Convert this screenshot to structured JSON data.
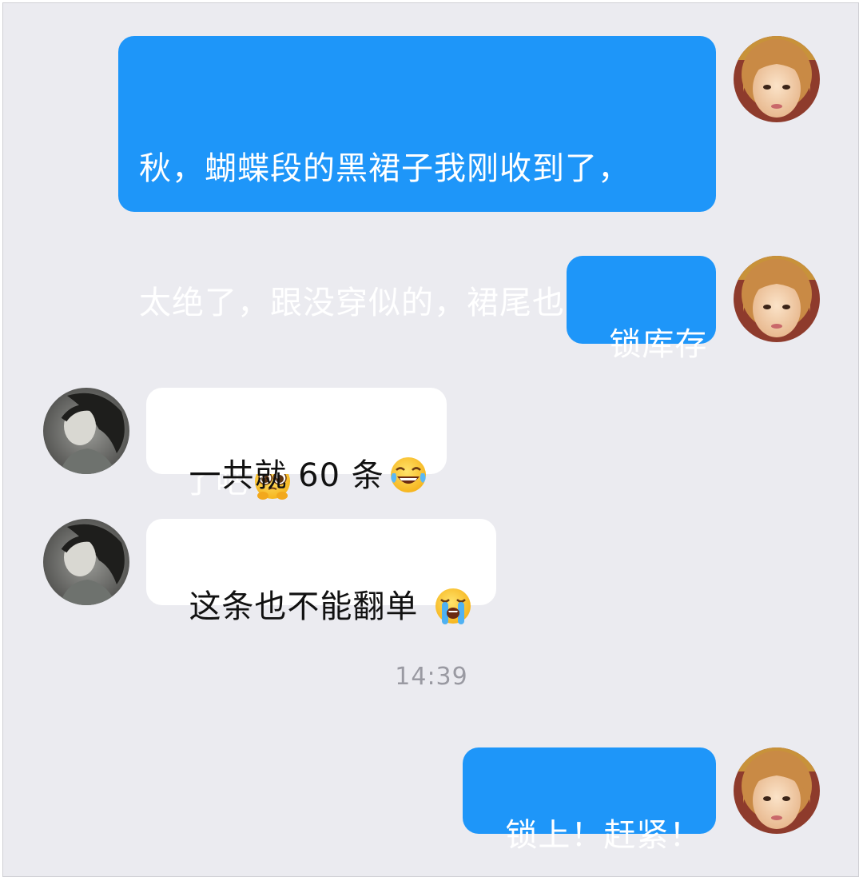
{
  "chat": {
    "messages": [
      {
        "direction": "outgoing",
        "lines": [
          "秋，蝴蝶段的黑裙子我刚收到了，",
          "太绝了，跟没穿似的，裙尾也太美",
          "了吧"
        ],
        "emoji": "pleading-face-emoji"
      },
      {
        "direction": "outgoing",
        "text": "锁库存"
      },
      {
        "direction": "incoming",
        "text": "一共就 60 条",
        "emoji": "tears-of-joy-emoji"
      },
      {
        "direction": "incoming",
        "text": "这条也不能翻单 ",
        "emoji": "loudly-crying-face-emoji"
      },
      {
        "direction": "outgoing",
        "text": "锁上！赶紧！"
      }
    ],
    "timestamp": "14:39"
  },
  "colors": {
    "background": "#ebebf0",
    "outgoing_bubble": "#1e96f9",
    "incoming_bubble": "#ffffff",
    "timestamp_text": "#9a9aa2"
  },
  "icons": {
    "self_avatar": "avatar-self-photo",
    "contact_avatar": "avatar-contact-photo"
  }
}
